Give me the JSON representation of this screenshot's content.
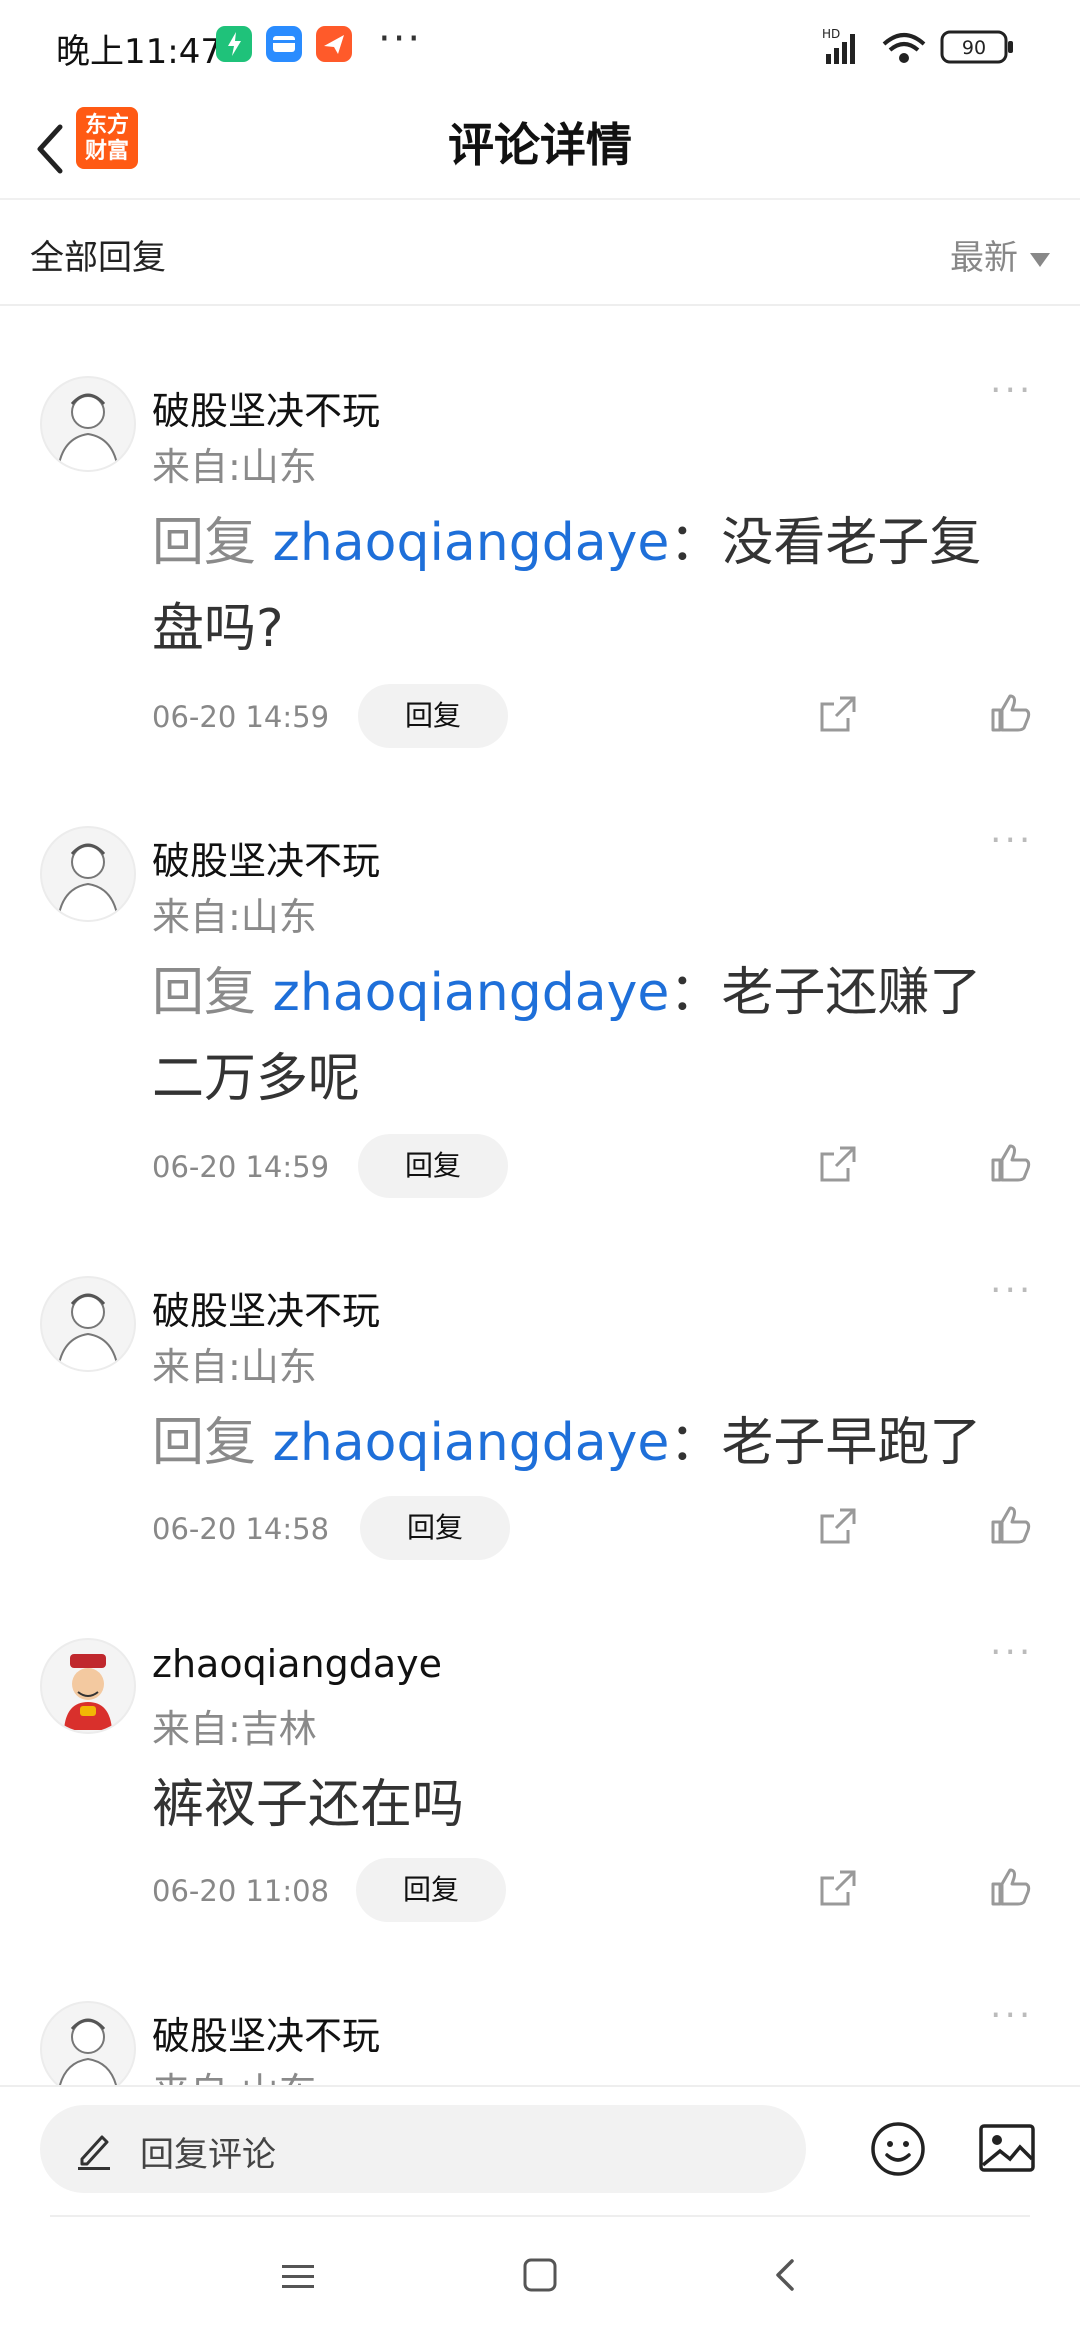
{
  "status_bar": {
    "time": "晚上11:47",
    "dots": "···",
    "battery": "90",
    "hd_label": "HD"
  },
  "header": {
    "logo_text_line1": "东方",
    "logo_text_line2": "财富",
    "title": "评论详情"
  },
  "filter": {
    "all_replies": "全部回复",
    "sort_label": "最新"
  },
  "comments": [
    {
      "username": "破股坚决不玩",
      "location": "来自:山东",
      "reply_prefix": "回复",
      "reply_user": "zhaoqiangdaye",
      "text": "：没看老子复盘吗?",
      "date": "06-20 14:59",
      "reply_button": "回复"
    },
    {
      "username": "破股坚决不玩",
      "location": "来自:山东",
      "reply_prefix": "回复",
      "reply_user": "zhaoqiangdaye",
      "text": "：老子还赚了二万多呢",
      "date": "06-20 14:59",
      "reply_button": "回复"
    },
    {
      "username": "破股坚决不玩",
      "location": "来自:山东",
      "reply_prefix": "回复",
      "reply_user": "zhaoqiangdaye",
      "text": "：老子早跑了",
      "date": "06-20 14:58",
      "reply_button": "回复"
    },
    {
      "username": "zhaoqiangdaye",
      "location": "来自:吉林",
      "text": "裤衩子还在吗",
      "date": "06-20 11:08",
      "reply_button": "回复"
    },
    {
      "username": "破股坚决不玩",
      "location": "来自:山东"
    }
  ],
  "bottom": {
    "input_placeholder": "回复评论"
  },
  "colors": {
    "accent_blue": "#1e6fd9",
    "brand_orange": "#ff5a14"
  }
}
